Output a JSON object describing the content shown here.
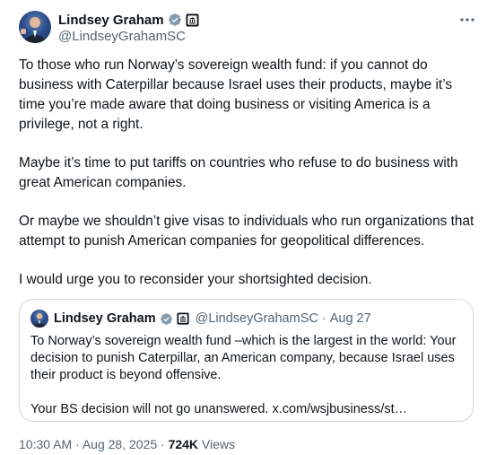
{
  "author": {
    "display_name": "Lindsey Graham",
    "handle": "@LindseyGrahamSC"
  },
  "tweet": {
    "paragraphs": [
      "To those who run Norway’s sovereign wealth fund: if you cannot do business with Caterpillar because Israel uses their products, maybe it’s time you’re made aware that doing business or visiting America is a privilege, not a right.",
      "Maybe it’s time to put tariffs on countries who refuse to do business with great American companies.",
      "Or maybe we shouldn’t give visas to individuals who run organizations that attempt to punish American companies for geopolitical differences.",
      "I would urge you to reconsider your shortsighted decision."
    ]
  },
  "quote": {
    "display_name": "Lindsey Graham",
    "handle": "@LindseyGrahamSC",
    "separator": "·",
    "date": "Aug 27",
    "paragraphs": [
      "To Norway’s sovereign wealth fund –which is the largest in the world: Your decision to punish Caterpillar, an American company, because Israel uses their product is beyond offensive.",
      "Your BS decision will not go unanswered. x.com/wsjbusiness/st…"
    ]
  },
  "meta": {
    "time": "10:30 AM",
    "separator1": " · ",
    "date": "Aug 28, 2025",
    "separator2": " · ",
    "views_count": "724K",
    "views_label": " Views"
  },
  "icons": {
    "verified": "verified-badge-icon",
    "government": "government-affiliation-icon",
    "more": "more-options-icon"
  },
  "colors": {
    "verified": "#829aab",
    "text_primary": "#0f1419",
    "text_secondary": "#536471",
    "border": "#cfd9de"
  }
}
